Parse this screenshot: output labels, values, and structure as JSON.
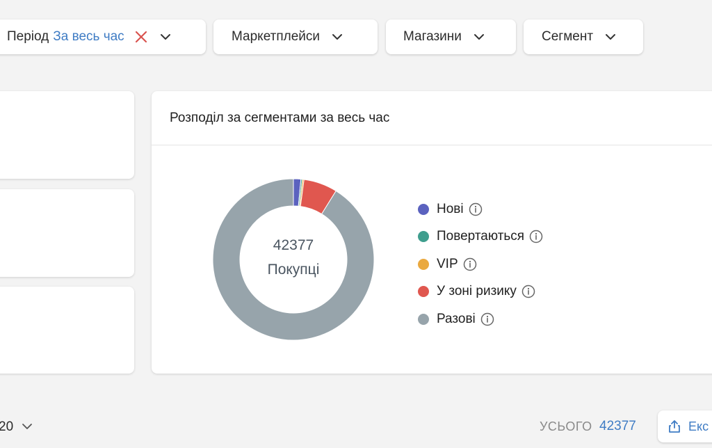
{
  "filters": {
    "period": {
      "label": "Період",
      "value": "За весь час"
    },
    "marketplaces": {
      "label": "Маркетплейси"
    },
    "stores": {
      "label": "Магазини"
    },
    "segment": {
      "label": "Сегмент"
    }
  },
  "card": {
    "title": "Розподіл за сегментами за весь час",
    "center_value": "42377",
    "center_label": "Покупці"
  },
  "chart_data": {
    "type": "pie",
    "categories": [
      "Нові",
      "Повертаються",
      "VIP",
      "У зоні ризику",
      "Разові"
    ],
    "values": [
      630,
      130,
      130,
      2860,
      38627
    ],
    "colors": [
      "#5b62bf",
      "#3f9e8e",
      "#eaa93f",
      "#e0574f",
      "#97a4ab"
    ],
    "total": 42377,
    "donut": true
  },
  "footer": {
    "rows_per_page": "20",
    "total_label": "УСЬОГО",
    "total_value": "42377",
    "export_label": "Екс"
  }
}
